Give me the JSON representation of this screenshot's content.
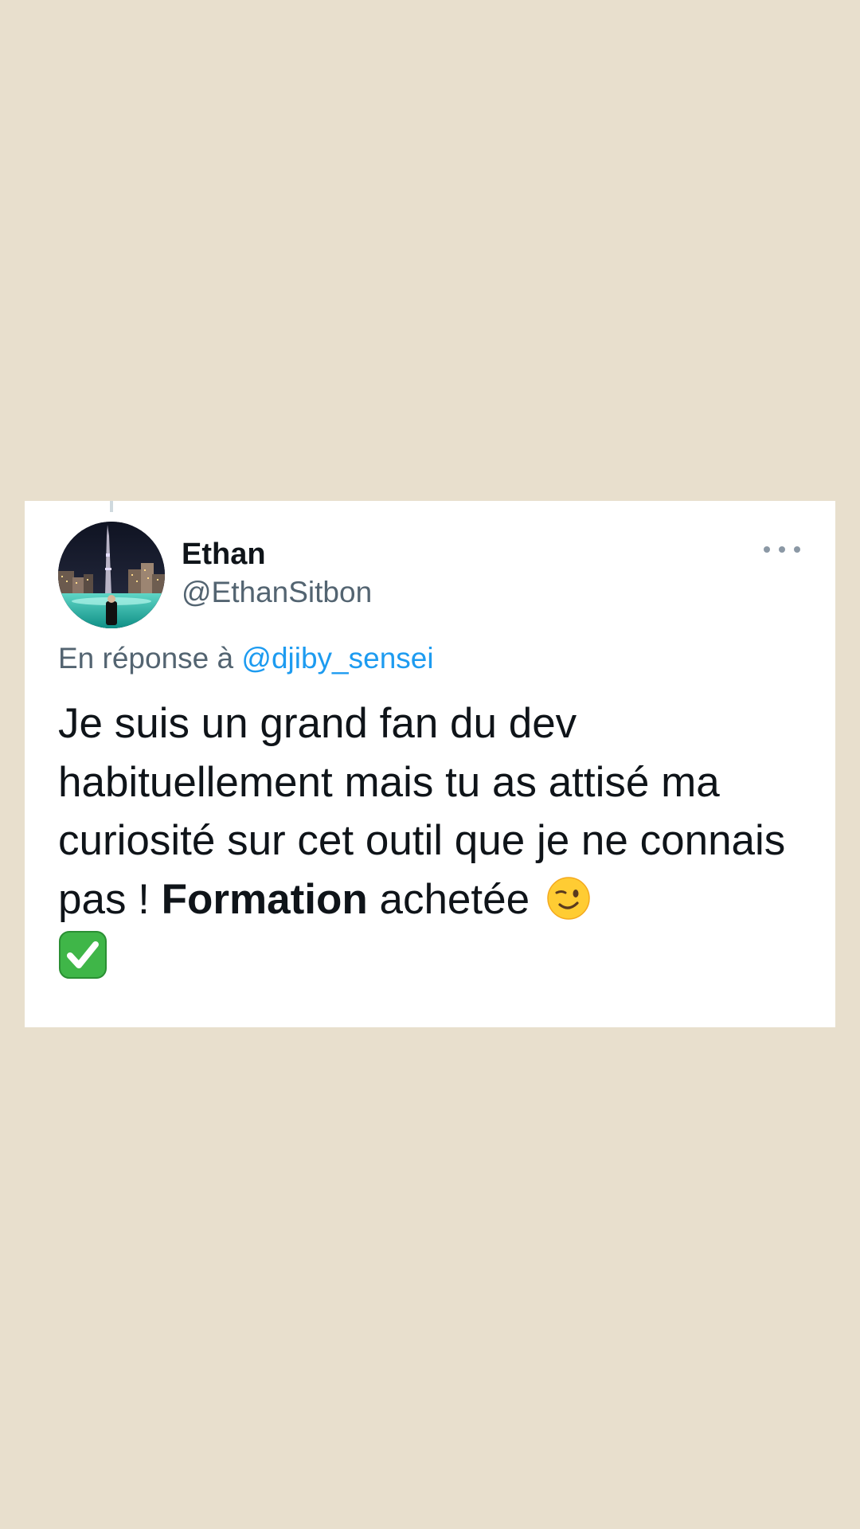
{
  "tweet": {
    "author_name": "Ethan",
    "author_handle": "@EthanSitbon",
    "reply_prefix": "En réponse à ",
    "reply_mention": "@djiby_sensei",
    "text_part1": "Je suis un grand fan du dev habituellement mais tu as attisé ma curiosité sur cet outil que je ne connais pas ! ",
    "text_bold": "Formation",
    "text_part2": " achetée ",
    "emojis": [
      "winking-face-emoji",
      "check-mark-button-emoji"
    ]
  },
  "icons": {
    "more": "more-options-icon",
    "avatar": "avatar"
  },
  "colors": {
    "page_background": "#e8dfcd",
    "card_background": "#ffffff",
    "text_primary": "#0f1419",
    "text_secondary": "#536471",
    "link": "#1d9bf0"
  }
}
